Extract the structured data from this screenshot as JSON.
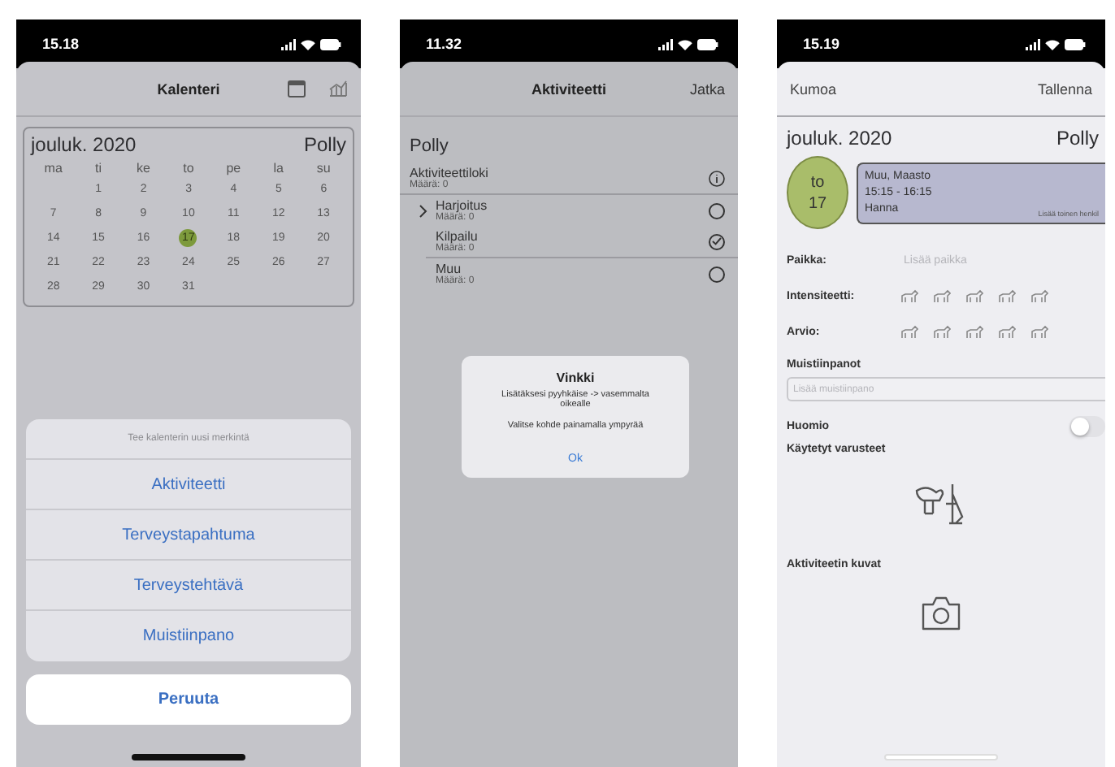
{
  "phones": [
    {
      "kind": "calendar",
      "status_time": "15.18",
      "nav_title": "Kalenteri",
      "calendar": {
        "month": "jouluk. 2020",
        "pet": "Polly",
        "weekdays": [
          "ma",
          "ti",
          "ke",
          "to",
          "pe",
          "la",
          "su"
        ],
        "weeks": [
          {
            "days": [
              {
                "label": "1",
                "selected": false
              },
              {
                "label": "2",
                "selected": false
              },
              {
                "label": "3",
                "selected": false
              },
              {
                "label": "4",
                "selected": false
              },
              {
                "label": "5",
                "selected": false
              },
              {
                "label": "6",
                "selected": false
              }
            ]
          },
          {
            "days": [
              {
                "label": "7",
                "selected": false
              },
              {
                "label": "8",
                "selected": false
              },
              {
                "label": "9",
                "selected": false
              },
              {
                "label": "10",
                "selected": false
              },
              {
                "label": "11",
                "selected": false
              },
              {
                "label": "12",
                "selected": false
              },
              {
                "label": "13",
                "selected": false
              }
            ]
          },
          {
            "days": [
              {
                "label": "14",
                "selected": false
              },
              {
                "label": "15",
                "selected": false
              },
              {
                "label": "16",
                "selected": false
              },
              {
                "label": "17",
                "selected": true
              },
              {
                "label": "18",
                "selected": false
              },
              {
                "label": "19",
                "selected": false
              },
              {
                "label": "20",
                "selected": false
              }
            ]
          },
          {
            "days": [
              {
                "label": "21",
                "selected": false
              },
              {
                "label": "22",
                "selected": false
              },
              {
                "label": "23",
                "selected": false
              },
              {
                "label": "24",
                "selected": false
              },
              {
                "label": "25",
                "selected": false
              },
              {
                "label": "26",
                "selected": false
              },
              {
                "label": "27",
                "selected": false
              }
            ]
          },
          {
            "days": [
              {
                "label": "28",
                "selected": false
              },
              {
                "label": "29",
                "selected": false
              },
              {
                "label": "30",
                "selected": false
              },
              {
                "label": "31",
                "selected": false
              }
            ]
          }
        ]
      },
      "action_sheet": {
        "title": "Tee kalenterin uusi merkintä",
        "options": [
          "Aktiviteetti",
          "Terveystapahtuma",
          "Terveystehtävä",
          "Muistiinpano"
        ],
        "cancel": "Peruuta"
      }
    },
    {
      "kind": "activity",
      "status_time": "11.32",
      "nav_title": "Aktiviteetti",
      "nav_action": "Jatka",
      "pet": "Polly",
      "log": {
        "label": "Aktiviteettiloki",
        "count": "Määrä: 0",
        "children": [
          {
            "label": "Harjoitus",
            "count": "Määrä: 0",
            "expandable": true,
            "selected": false
          },
          {
            "label": "Kilpailu",
            "count": "Määrä: 0",
            "expandable": false,
            "selected": true
          },
          {
            "label": "Muu",
            "count": "Määrä: 0",
            "expandable": false,
            "selected": false
          }
        ]
      },
      "alert": {
        "title": "Vinkki",
        "lines": [
          "Lisätäksesi pyyhkäise -> vasemmalta oikealle",
          "Valitse kohde painamalla ympyrää"
        ],
        "button": "Ok"
      }
    },
    {
      "kind": "entry",
      "status_time": "15.19",
      "cancel": "Kumoa",
      "save": "Tallenna",
      "month": "jouluk. 2020",
      "pet": "Polly",
      "day": {
        "weekday": "to",
        "date": "17"
      },
      "event": {
        "title": "Muu, Maasto",
        "time": "15:15 - 16:15",
        "person": "Hanna",
        "add_person": "Lisää toinen henkil"
      },
      "place": {
        "label": "Paikka:",
        "placeholder": "Lisää paikka"
      },
      "ratings": [
        {
          "label": "Intensiteetti:",
          "stars": 0
        },
        {
          "label": "Arvio:",
          "stars": 0
        }
      ],
      "notes": {
        "label": "Muistiinpanot",
        "placeholder": "Lisää muistiinpano"
      },
      "flag": {
        "label": "Huomio",
        "on": false
      },
      "equipment_label": "Käytetyt varusteet",
      "photos_label": "Aktiviteetin kuvat"
    }
  ]
}
